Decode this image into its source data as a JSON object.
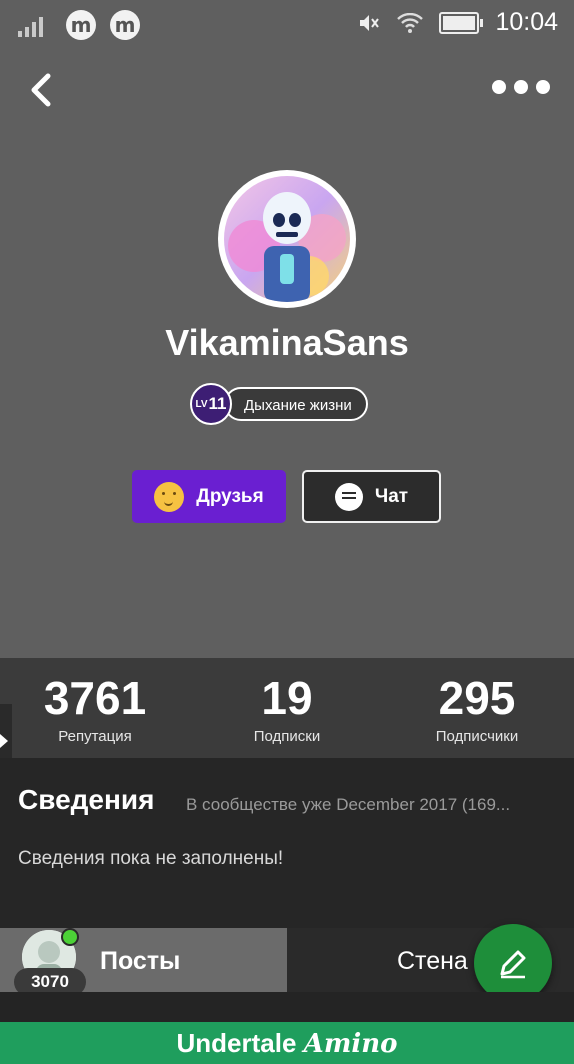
{
  "status_bar": {
    "time": "10:04"
  },
  "profile": {
    "username": "VikaminaSans",
    "level": "11",
    "level_prefix": "LV",
    "level_title": "Дыхание жизни"
  },
  "actions": {
    "friends_label": "Друзья",
    "chat_label": "Чат"
  },
  "stats": [
    {
      "value": "3761",
      "label": "Репутация"
    },
    {
      "value": "19",
      "label": "Подписки"
    },
    {
      "value": "295",
      "label": "Подписчики"
    }
  ],
  "info": {
    "title": "Сведения",
    "member_since": "В сообществе уже December 2017 (169...",
    "empty_text": "Сведения пока не заполнены!"
  },
  "tabs": {
    "posts_label": "Посты",
    "wall_label": "Стена",
    "posts_count": "3070"
  },
  "footer": {
    "brand_main": "Undertale",
    "brand_suffix": "Amino"
  },
  "colors": {
    "accent_purple": "#6a1fd1",
    "fab_green": "#1e8e3a",
    "footer_green": "#1f9e5d"
  },
  "icons": [
    "back-icon",
    "more-icon",
    "smiley-icon",
    "chat-icon",
    "edit-icon",
    "signal-icon",
    "wifi-icon",
    "mute-icon",
    "battery-icon"
  ]
}
